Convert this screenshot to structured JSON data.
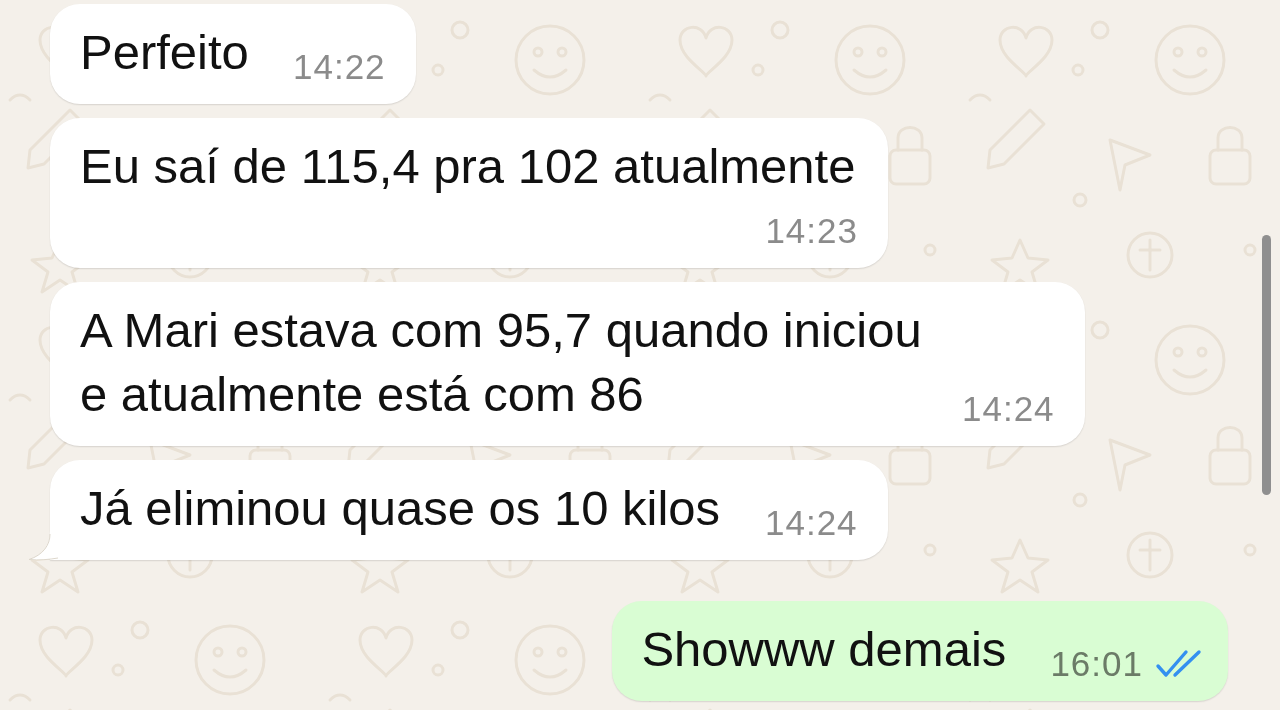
{
  "messages": [
    {
      "kind": "incoming",
      "text": "Perfeito",
      "time": "14:22",
      "tail": false
    },
    {
      "kind": "incoming",
      "text": "Eu saí de 115,4 pra 102 atualmente",
      "time": "14:23",
      "tail": false
    },
    {
      "kind": "incoming",
      "text": "A Mari estava com 95,7 quando iniciou e atualmente está com 86",
      "time": "14:24",
      "tail": false
    },
    {
      "kind": "incoming",
      "text": "Já eliminou quase os 10 kilos",
      "time": "14:24",
      "tail": true
    },
    {
      "kind": "outgoing",
      "text": "Showww demais",
      "time": "16:01",
      "tail": false,
      "read": true
    }
  ]
}
